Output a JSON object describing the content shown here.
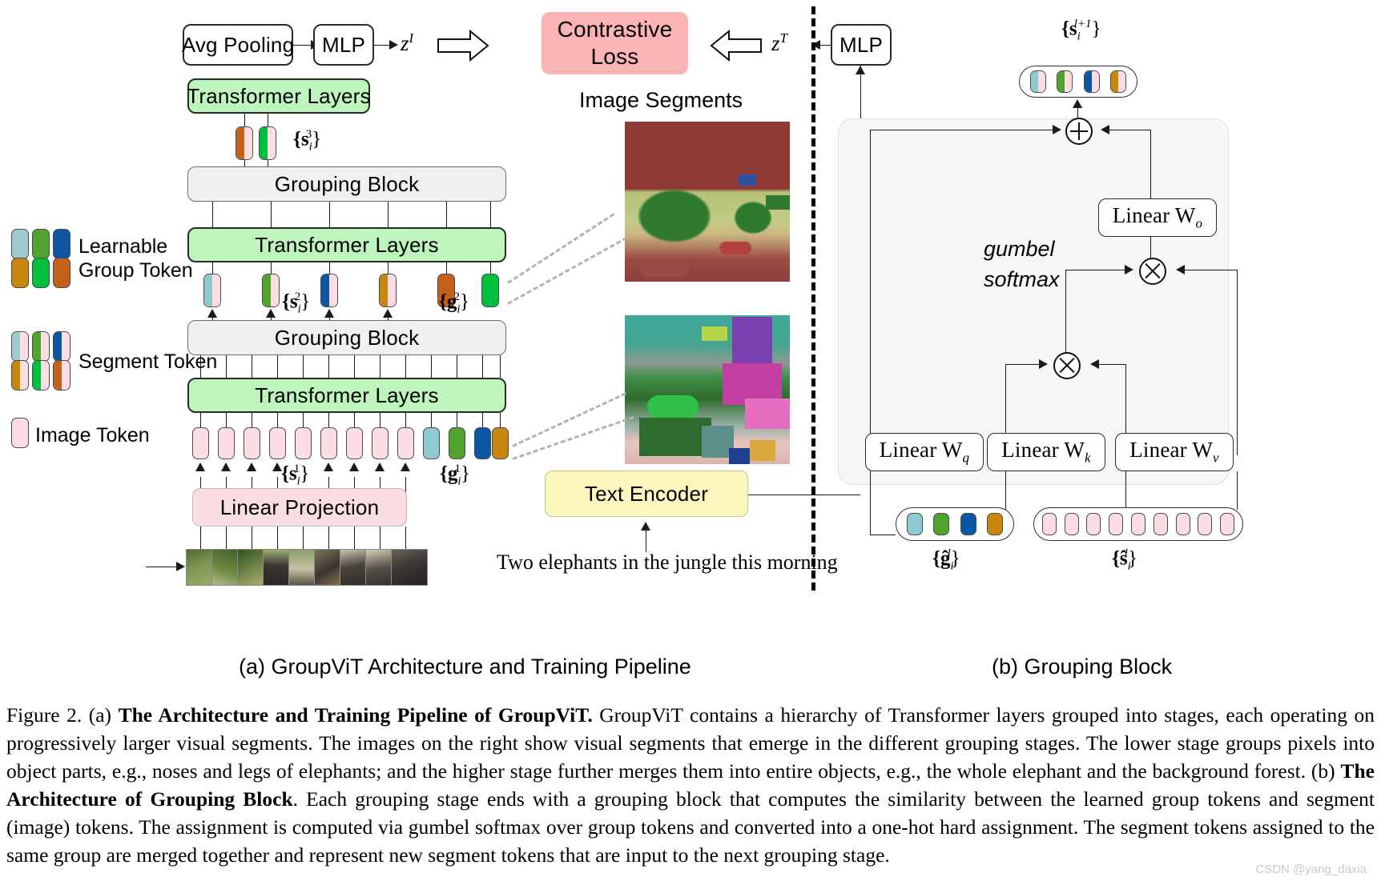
{
  "figure": {
    "panel_a_caption": "(a) GroupViT Architecture and Training Pipeline",
    "panel_b_caption": "(b) Grouping Block",
    "watermark": "CSDN @yang_daxia"
  },
  "panel_a": {
    "boxes": {
      "avg_pooling": "Avg Pooling",
      "mlp_image": "MLP",
      "mlp_text": "MLP",
      "contrastive_loss": "Contrastive\nLoss",
      "transformer_layers_3": "Transformer Layers",
      "transformer_layers_2": "Transformer Layers",
      "transformer_layers_1": "Transformer Layers",
      "grouping_block_2": "Grouping Block",
      "grouping_block_1": "Grouping Block",
      "linear_projection": "Linear Projection",
      "text_encoder": "Text Encoder"
    },
    "labels": {
      "z_image": "z",
      "z_image_sup": "I",
      "z_text": "z",
      "z_text_sup": "T",
      "image_segments": "Image Segments",
      "caption_text": "Two elephants in the jungle this morning",
      "s3": "{s",
      "s3_sub": "i",
      "s3_sup": "3",
      "s2": "{s",
      "s2_sub": "i",
      "s2_sup": "2",
      "s1": "{s",
      "s1_sub": "i",
      "s1_sup": "1",
      "g2": "{g",
      "g2_sub": "i",
      "g2_sup": "2",
      "g1": "{g",
      "g1_sub": "i",
      "g1_sup": "1"
    },
    "legend": [
      {
        "name": "learnable-group-token",
        "line1": "Learnable",
        "line2": "Group Token"
      },
      {
        "name": "segment-token",
        "line1": "Segment Token",
        "line2": ""
      },
      {
        "name": "image-token",
        "line1": "Image Token",
        "line2": ""
      }
    ]
  },
  "panel_b": {
    "boxes": {
      "linear_wo": "Linear W",
      "linear_wo_sub": "o",
      "linear_wq": "Linear W",
      "linear_wq_sub": "q",
      "linear_wk": "Linear W",
      "linear_wk_sub": "k",
      "linear_wv": "Linear W",
      "linear_wv_sub": "v"
    },
    "labels": {
      "gumbel": "gumbel",
      "softmax": "softmax",
      "out_tokens": "{s",
      "out_tokens_sub": "i",
      "out_tokens_sup": "l+1",
      "g_hat": "{ĝ",
      "g_hat_sub": "i",
      "g_hat_sup": "l",
      "s_hat": "{ŝ",
      "s_hat_sub": "i",
      "s_hat_sup": "l",
      "plus_op": "+",
      "times_op": "×"
    }
  },
  "colors": {
    "group_teal": "#8ecbd1",
    "group_green": "#4fa32e",
    "group_blue": "#0b57a4",
    "group_gold": "#c8860d",
    "group_green2": "#00bf3f",
    "group_orange": "#c4601a",
    "image_token_pink": "#fbdde3",
    "transformer_green": "#bdf5bd",
    "grouping_grey": "#eff0f0",
    "linear_proj_pink": "#fadde0",
    "contrastive_red": "#fbb4b4",
    "text_encoder_yellow": "#fbf7bf"
  },
  "caption": {
    "prefix": "Figure 2. (a) ",
    "bold1": "The Architecture and Training Pipeline of GroupViT.",
    "body1": " GroupViT contains a hierarchy of Transformer layers grouped into stages, each operating on progressively larger visual segments. The images on the right show visual segments that emerge in the different grouping stages. The lower stage groups pixels into object parts, e.g., noses and legs of elephants; and the higher stage further merges them into entire objects, e.g., the whole elephant and the background forest.  (b) ",
    "bold2": "The Architecture of Grouping Block",
    "body2": ". Each grouping stage ends with a grouping block that computes the similarity between the learned group tokens and segment (image) tokens. The assignment is computed via gumbel softmax over group tokens and converted into a one-hot hard assignment. The segment tokens assigned to the same group are merged together and represent new segment tokens that are input to the next grouping stage."
  }
}
